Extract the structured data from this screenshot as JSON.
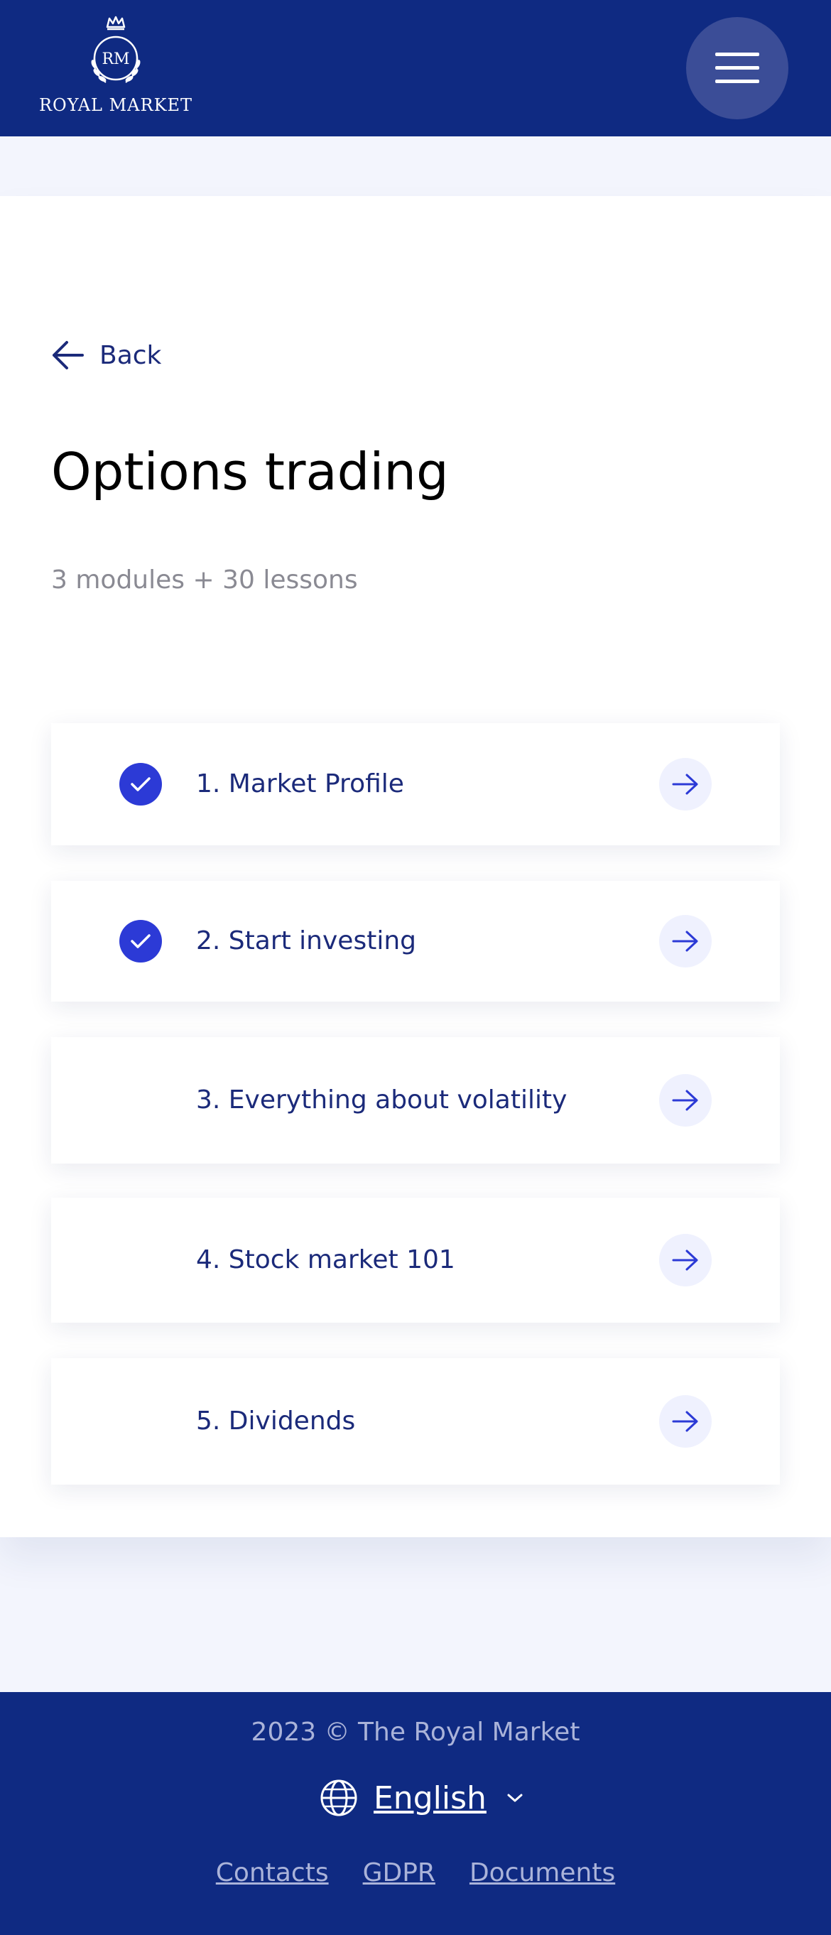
{
  "header": {
    "logo_monogram": "RM",
    "logo_text": "ROYAL MARKET",
    "menu_icon": "hamburger-icon"
  },
  "page": {
    "back_label": "Back",
    "title": "Options trading",
    "subtitle": "3 modules + 30 lessons"
  },
  "modules": [
    {
      "label": "1. Market Profile",
      "completed": true
    },
    {
      "label": "2. Start investing",
      "completed": true
    },
    {
      "label": "3. Everything about volatility",
      "completed": false
    },
    {
      "label": "4. Stock market 101",
      "completed": false
    },
    {
      "label": "5. Dividends",
      "completed": false
    }
  ],
  "footer": {
    "copyright": "2023 © The Royal Market",
    "language": "English",
    "links": [
      "Contacts",
      "GDPR",
      "Documents"
    ]
  },
  "colors": {
    "brand_navy": "#0f2a82",
    "accent_blue": "#2c3ad6",
    "text_navy": "#1b2a7a",
    "muted_gray": "#8a8a93",
    "page_bg": "#f3f5fd"
  }
}
